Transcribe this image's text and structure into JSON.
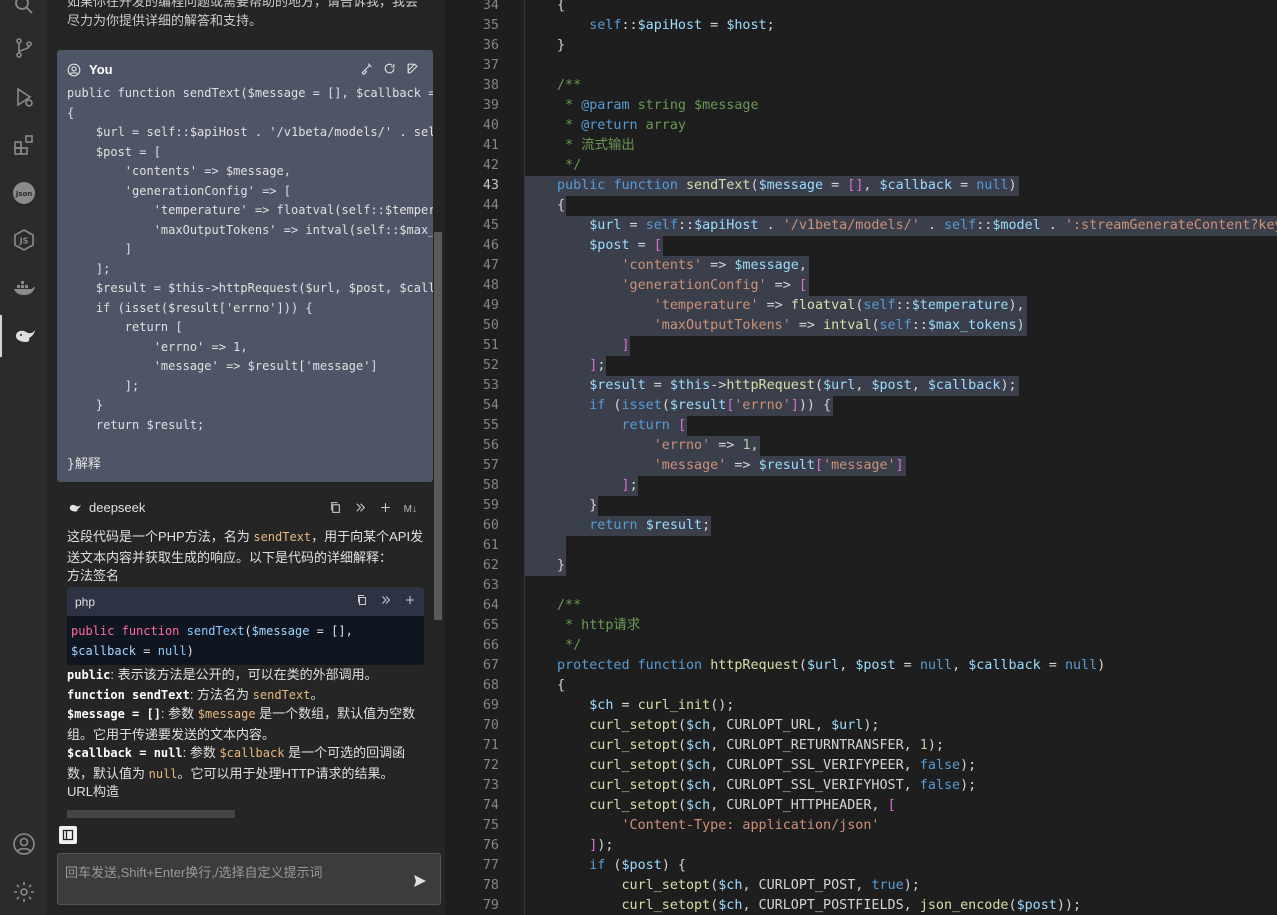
{
  "activity_bar": {
    "icons": [
      "search-icon",
      "source-control-icon",
      "run-debug-icon",
      "extensions-icon",
      "json-icon",
      "js-icon",
      "docker-icon",
      "deepseek-icon",
      "account-icon",
      "settings-icon"
    ]
  },
  "chat": {
    "prev_text": "如果你在开发的编程问题或需要帮助的地方，请告诉我，我会尽力为你提供详细的解答和支持。",
    "you_label": "You",
    "user_code": "public function sendText($message = [], $callback = null)\n{\n    $url = self::$apiHost . '/v1beta/models/' . self::$model . ':streamGenerateContent?key=' . self::$apiKey;\n    $post = [\n        'contents' => $message,\n        'generationConfig' => [\n            'temperature' => floatval(self::$temperature),\n            'maxOutputTokens' => intval(self::$max_tokens)\n        ]\n    ];\n    $result = $this->httpRequest($url, $post, $callback);\n    if (isset($result['errno'])) {\n        return [\n            'errno' => 1,\n            'message' => $result['message']\n        ];\n    }\n    return $result;\n",
    "user_tail": "}解释",
    "ai_label": "deepseek",
    "ai_badge": "M↓",
    "ai_intro_1": "这段代码是一个PHP方法，名为 ",
    "ai_intro_code": "sendText",
    "ai_intro_2": "，用于向某个API发送文本内容并获取生成的响应。以下是代码的详细解释：",
    "section_signature": "方法签名",
    "code_lang": "php",
    "sig_kw1": "public",
    "sig_kw2": "function",
    "sig_fn": "sendText",
    "sig_arg1": "$message",
    "sig_arg1_default": " = [],",
    "sig_arg2": "$callback",
    "sig_arg2_default": " = ",
    "sig_null": "null",
    "sig_close": ")",
    "b1_code": "public",
    "b1_text": ": 表示该方法是公开的，可以在类的外部调用。",
    "b2_code": "function sendText",
    "b2_text": ": 方法名为 ",
    "b2_inline": "sendText",
    "b2_end": "。",
    "b3_code": "$message = []",
    "b3_text": ": 参数 ",
    "b3_inline": "$message",
    "b3_text2": " 是一个数组，默认值为空数组。它用于传递要发送的文本内容。",
    "b4_code": "$callback = null",
    "b4_text": ": 参数 ",
    "b4_inline": "$callback",
    "b4_text2": " 是一个可选的回调函数，默认值为 ",
    "b4_inline2": "null",
    "b4_text3": "。它可以用于处理HTTP请求的结果。",
    "section_url": "URL构造",
    "input_placeholder": "回车发送,Shift+Enter换行,/选择自定义提示词"
  },
  "editor": {
    "current_line": 43,
    "line_numbers": [
      "34",
      "35",
      "36",
      "37",
      "38",
      "39",
      "40",
      "41",
      "42",
      "43",
      "44",
      "45",
      "46",
      "47",
      "48",
      "49",
      "50",
      "51",
      "52",
      "53",
      "54",
      "55",
      "56",
      "57",
      "58",
      "59",
      "60",
      "61",
      "62",
      "63",
      "64",
      "65",
      "66",
      "67",
      "68",
      "69",
      "70",
      "71",
      "72",
      "73",
      "74",
      "75",
      "76",
      "77",
      "78",
      "79"
    ],
    "lines": [
      "    {",
      "        self::$apiHost = $host;",
      "    }",
      "",
      "    /**",
      "     * @param string $message",
      "     * @return array",
      "     * 流式输出",
      "     */",
      "    public function sendText($message = [], $callback = null)",
      "    {",
      "        $url = self::$apiHost . '/v1beta/models/' . self::$model . ':streamGenerateContent?key=' . self::$apiKey;",
      "        $post = [",
      "            'contents' => $message,",
      "            'generationConfig' => [",
      "                'temperature' => floatval(self::$temperature),",
      "                'maxOutputTokens' => intval(self::$max_tokens)",
      "            ]",
      "        ];",
      "        $result = $this->httpRequest($url, $post, $callback);",
      "        if (isset($result['errno'])) {",
      "            return [",
      "                'errno' => 1,",
      "                'message' => $result['message']",
      "            ];",
      "        }",
      "        return $result;",
      "",
      "    }",
      "",
      "    /**",
      "     * http请求",
      "     */",
      "    protected function httpRequest($url, $post = null, $callback = null)",
      "    {",
      "        $ch = curl_init();",
      "        curl_setopt($ch, CURLOPT_URL, $url);",
      "        curl_setopt($ch, CURLOPT_RETURNTRANSFER, 1);",
      "        curl_setopt($ch, CURLOPT_SSL_VERIFYPEER, false);",
      "        curl_setopt($ch, CURLOPT_SSL_VERIFYHOST, false);",
      "        curl_setopt($ch, CURLOPT_HTTPHEADER, [",
      "            'Content-Type: application/json'",
      "        ]);",
      "        if ($post) {",
      "            curl_setopt($ch, CURLOPT_POST, true);",
      "            curl_setopt($ch, CURLOPT_POSTFIELDS, json_encode($post));"
    ]
  }
}
